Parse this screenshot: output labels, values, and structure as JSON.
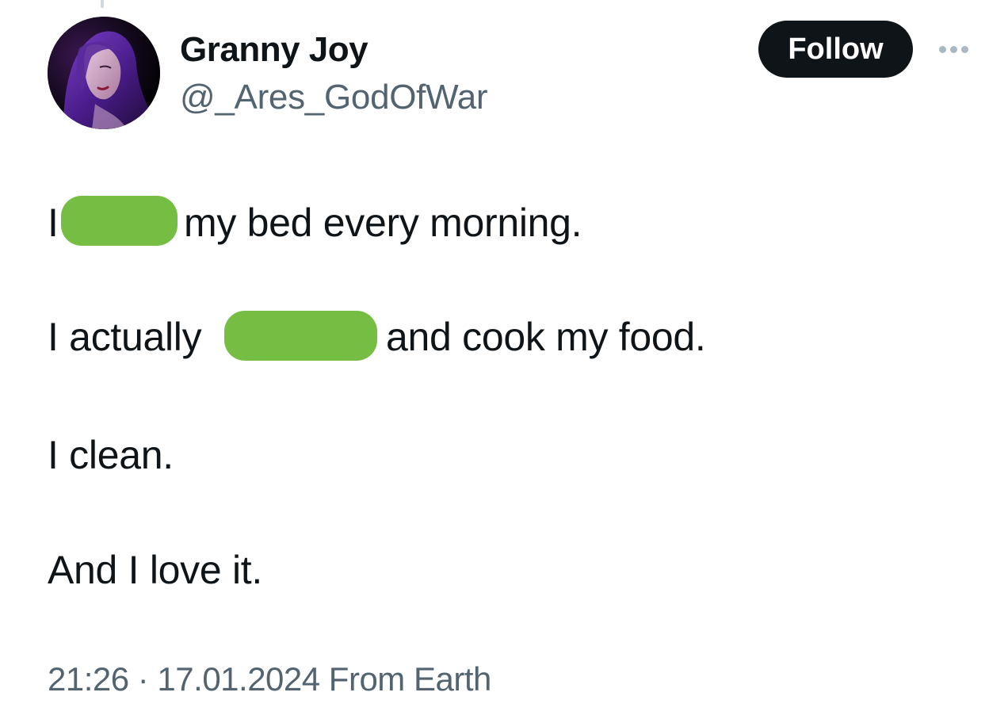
{
  "author": {
    "display_name": "Granny Joy",
    "handle": "@_Ares_GodOfWar"
  },
  "actions": {
    "follow_label": "Follow",
    "more_icon": "more-horizontal-icon"
  },
  "tweet": {
    "line1_start": "I",
    "line1_end": "my bed every morning.",
    "line2_start": "I actually",
    "line2_end": "and cook my food.",
    "line3": "I clean.",
    "line4": "And I love it."
  },
  "meta": {
    "timestamp": "21:26 · 17.01.2024 From Earth"
  },
  "colors": {
    "text": "#0f1419",
    "secondary_text": "#536471",
    "follow_bg": "#0f1419",
    "redaction": "#76bd43"
  }
}
